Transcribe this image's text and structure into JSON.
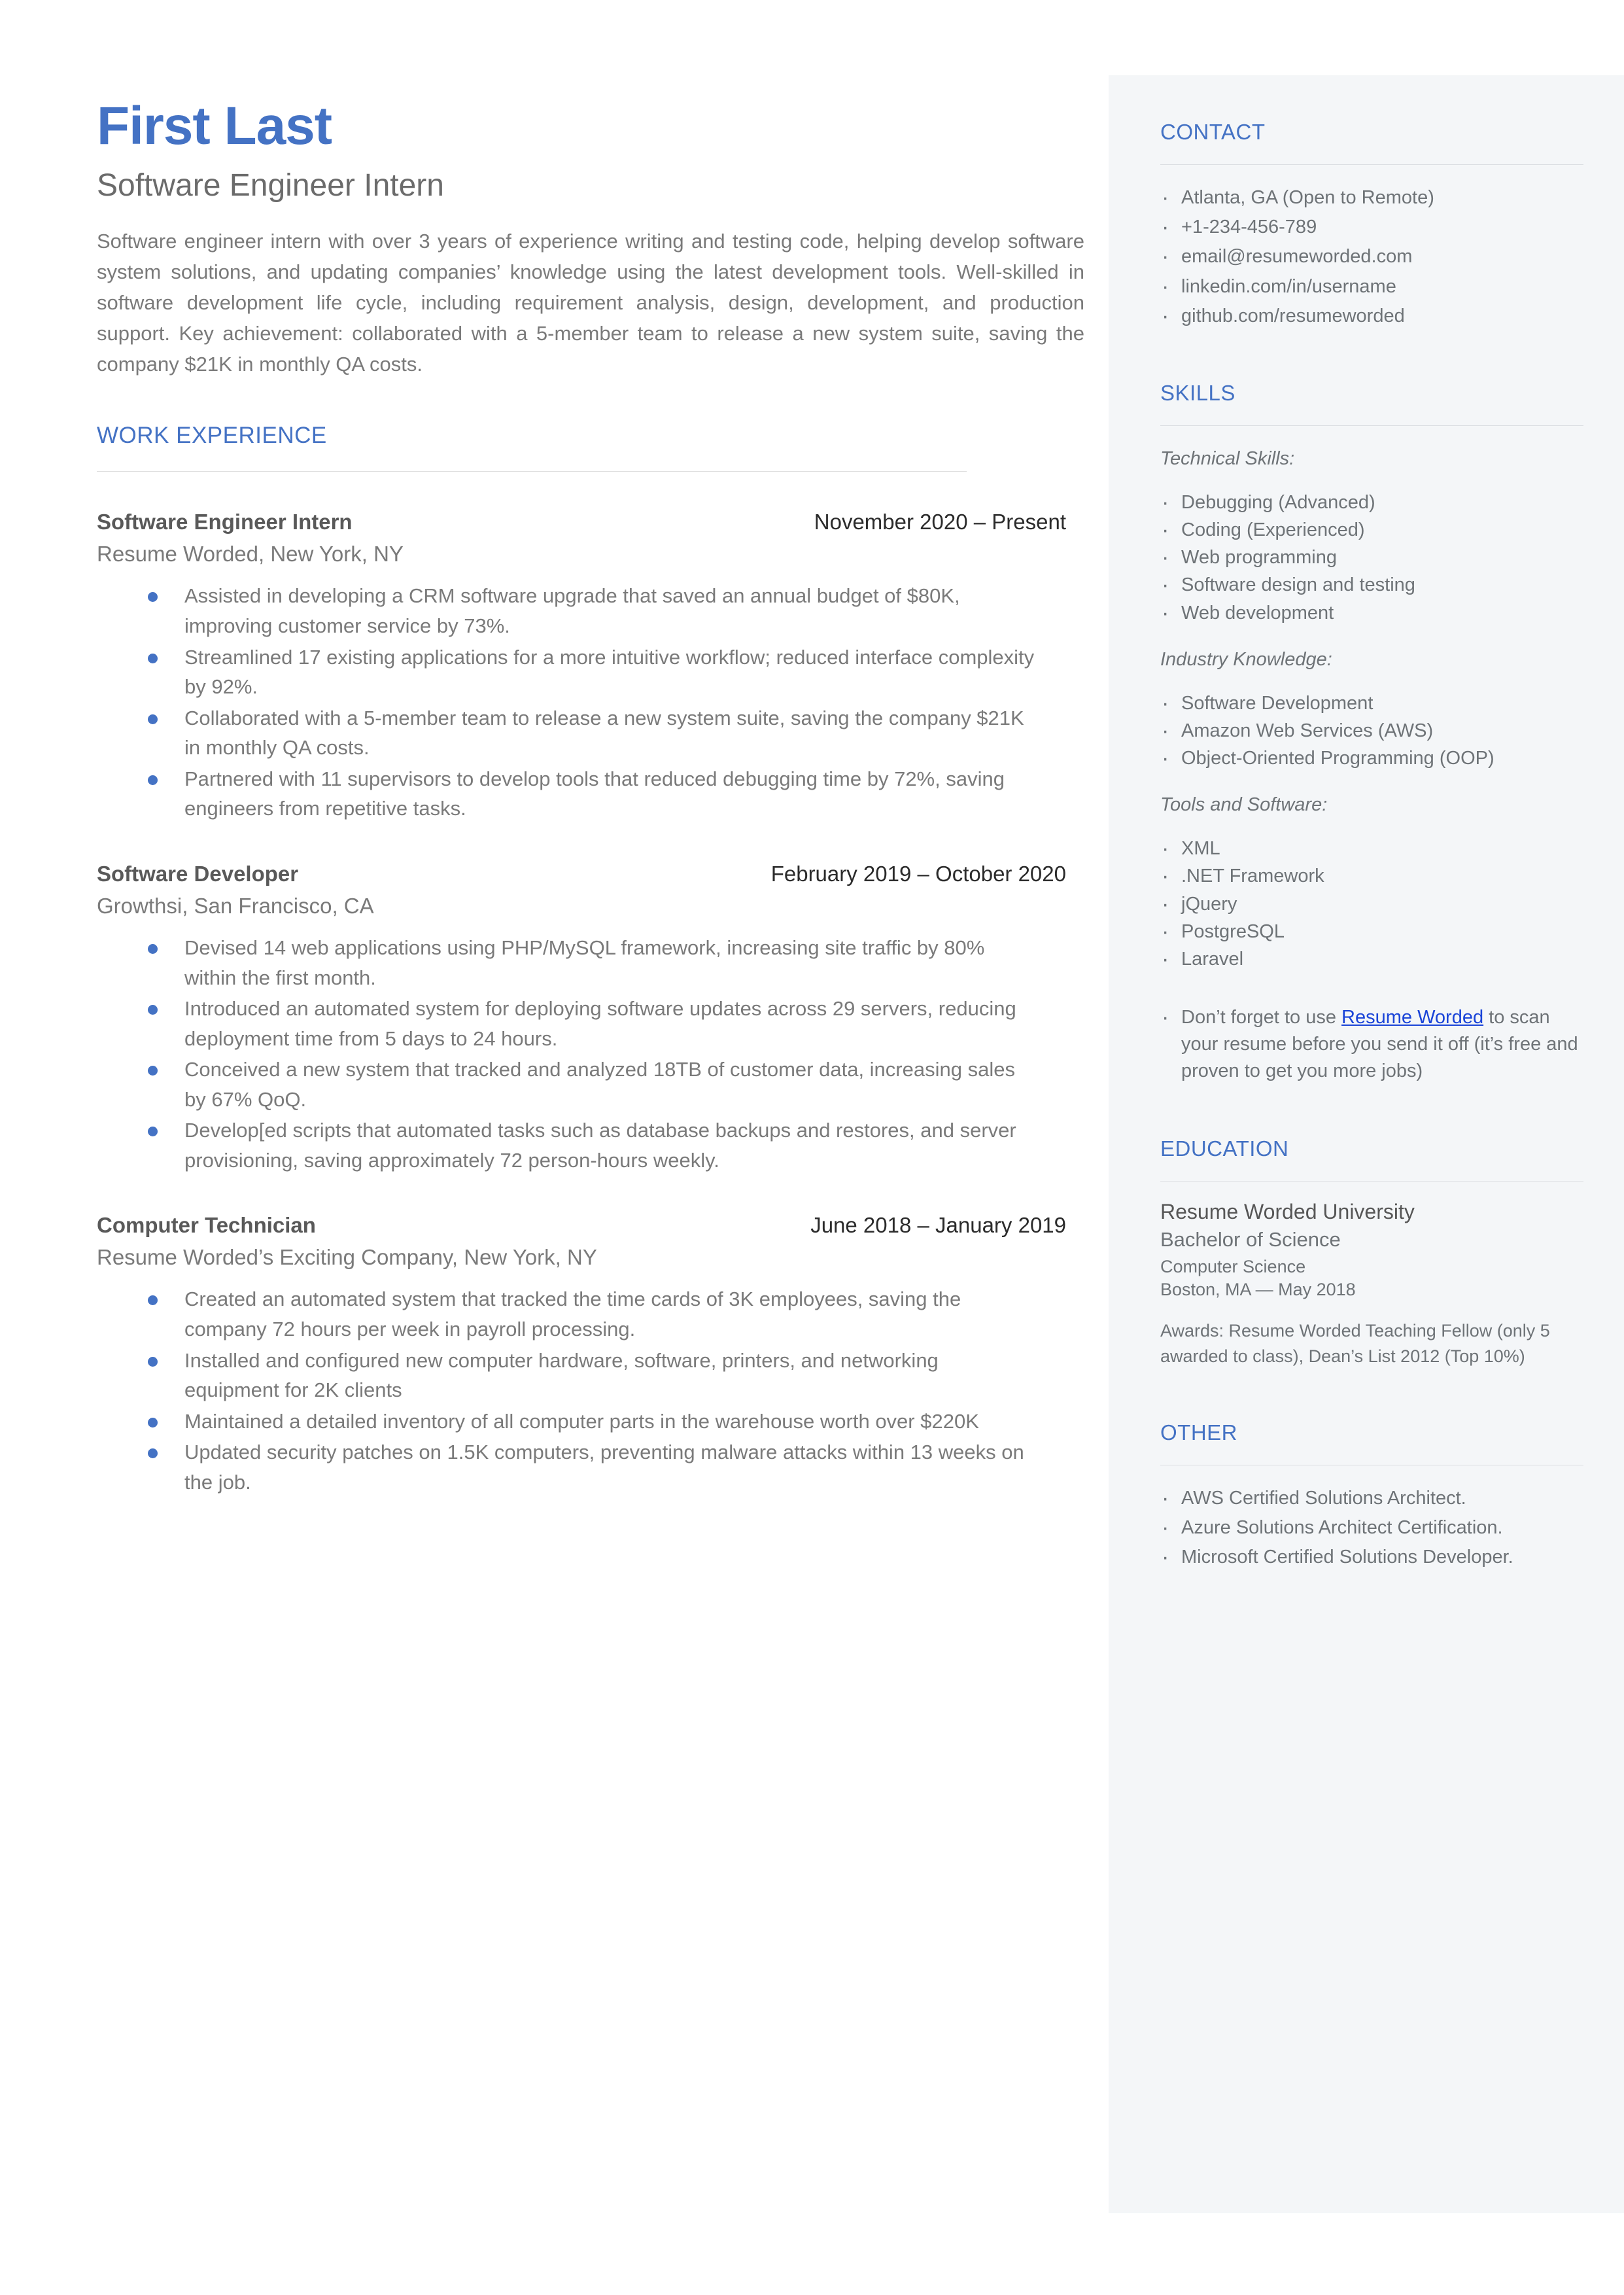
{
  "colors": {
    "accent_blue": "#4472C4",
    "link_blue": "#1a44d8",
    "body_gray": "#7a7a7a",
    "sidebar_bg": "#f4f6f8"
  },
  "header": {
    "name": "First Last",
    "headline": "Software Engineer Intern",
    "summary": "Software engineer intern with over 3 years of experience writing and testing code, helping develop software system solutions, and updating companies’  knowledge using the latest development tools.  Well-skilled in  software development life cycle, including requirement analysis, design, development, and production support. Key achievement: collaborated with a 5-member team to release a new system suite, saving the company $21K in monthly QA costs."
  },
  "work": {
    "section_title": "WORK EXPERIENCE",
    "jobs": [
      {
        "title": "Software Engineer Intern",
        "dates": "November 2020 – Present",
        "company": "Resume Worded, New York, NY",
        "bullets": [
          "Assisted in developing a CRM software upgrade that saved an annual budget of $80K, improving customer service by 73%.",
          "Streamlined 17 existing applications for a more intuitive workflow; reduced interface complexity by 92%.",
          "Collaborated with a 5-member team to release a new system suite, saving the company $21K in monthly QA costs.",
          "Partnered with 11 supervisors to develop tools that reduced debugging time by 72%, saving engineers from repetitive tasks."
        ]
      },
      {
        "title": "Software Developer",
        "dates": "February 2019 – October 2020",
        "company": "Growthsi, San Francisco, CA",
        "bullets": [
          "Devised 14 web applications using PHP/MySQL framework, increasing site traffic by 80% within the first month.",
          "Introduced an automated system for deploying software updates across 29 servers, reducing deployment time from 5 days to 24 hours.",
          "Conceived a new system that tracked and analyzed 18TB of customer data, increasing sales by 67% QoQ.",
          "Develop[ed scripts that automated tasks such as database backups and restores, and server provisioning, saving approximately 72 person-hours weekly."
        ]
      },
      {
        "title": "Computer Technician",
        "dates": "June 2018 – January 2019",
        "company": "Resume Worded’s Exciting Company, New York, NY",
        "bullets": [
          "Created an automated system that tracked the time cards of 3K employees, saving the company 72 hours per week in payroll processing.",
          "Installed and configured new computer hardware, software, printers, and networking equipment for 2K clients",
          "Maintained a detailed inventory of all computer parts in the warehouse worth over $220K",
          "Updated security patches on 1.5K computers, preventing malware attacks within 13 weeks on the job."
        ]
      }
    ]
  },
  "sidebar": {
    "contact": {
      "title": "CONTACT",
      "items": [
        "Atlanta, GA (Open to Remote)",
        "+1-234-456-789",
        "email@resumeworded.com",
        "linkedin.com/in/username",
        "github.com/resumeworded"
      ]
    },
    "skills": {
      "title": "SKILLS",
      "groups": [
        {
          "label": "Technical Skills:",
          "items": [
            "Debugging (Advanced)",
            "Coding (Experienced)",
            "Web programming",
            "Software design and testing",
            "Web development"
          ]
        },
        {
          "label": "Industry Knowledge:",
          "items": [
            "Software Development",
            "Amazon Web Services (AWS)",
            "Object-Oriented Programming (OOP)"
          ]
        },
        {
          "label": "Tools and Software:",
          "items": [
            "XML",
            ".NET Framework",
            "jQuery",
            "PostgreSQL",
            "Laravel"
          ]
        }
      ],
      "promo_before": "Don’t forget to use ",
      "promo_link": "Resume Worded",
      "promo_after": " to scan your resume before you send it off (it’s free and proven to get you more jobs)"
    },
    "education": {
      "title": "EDUCATION",
      "school": "Resume Worded University",
      "degree": "Bachelor of Science",
      "field": "Computer Science",
      "location_date": "Boston, MA — May 2018",
      "awards": "Awards: Resume Worded Teaching Fellow (only 5 awarded to class), Dean’s List 2012 (Top 10%)"
    },
    "other": {
      "title": "OTHER",
      "items": [
        "AWS Certified Solutions Architect.",
        "Azure Solutions Architect Certification.",
        "Microsoft Certified Solutions Developer."
      ]
    }
  }
}
